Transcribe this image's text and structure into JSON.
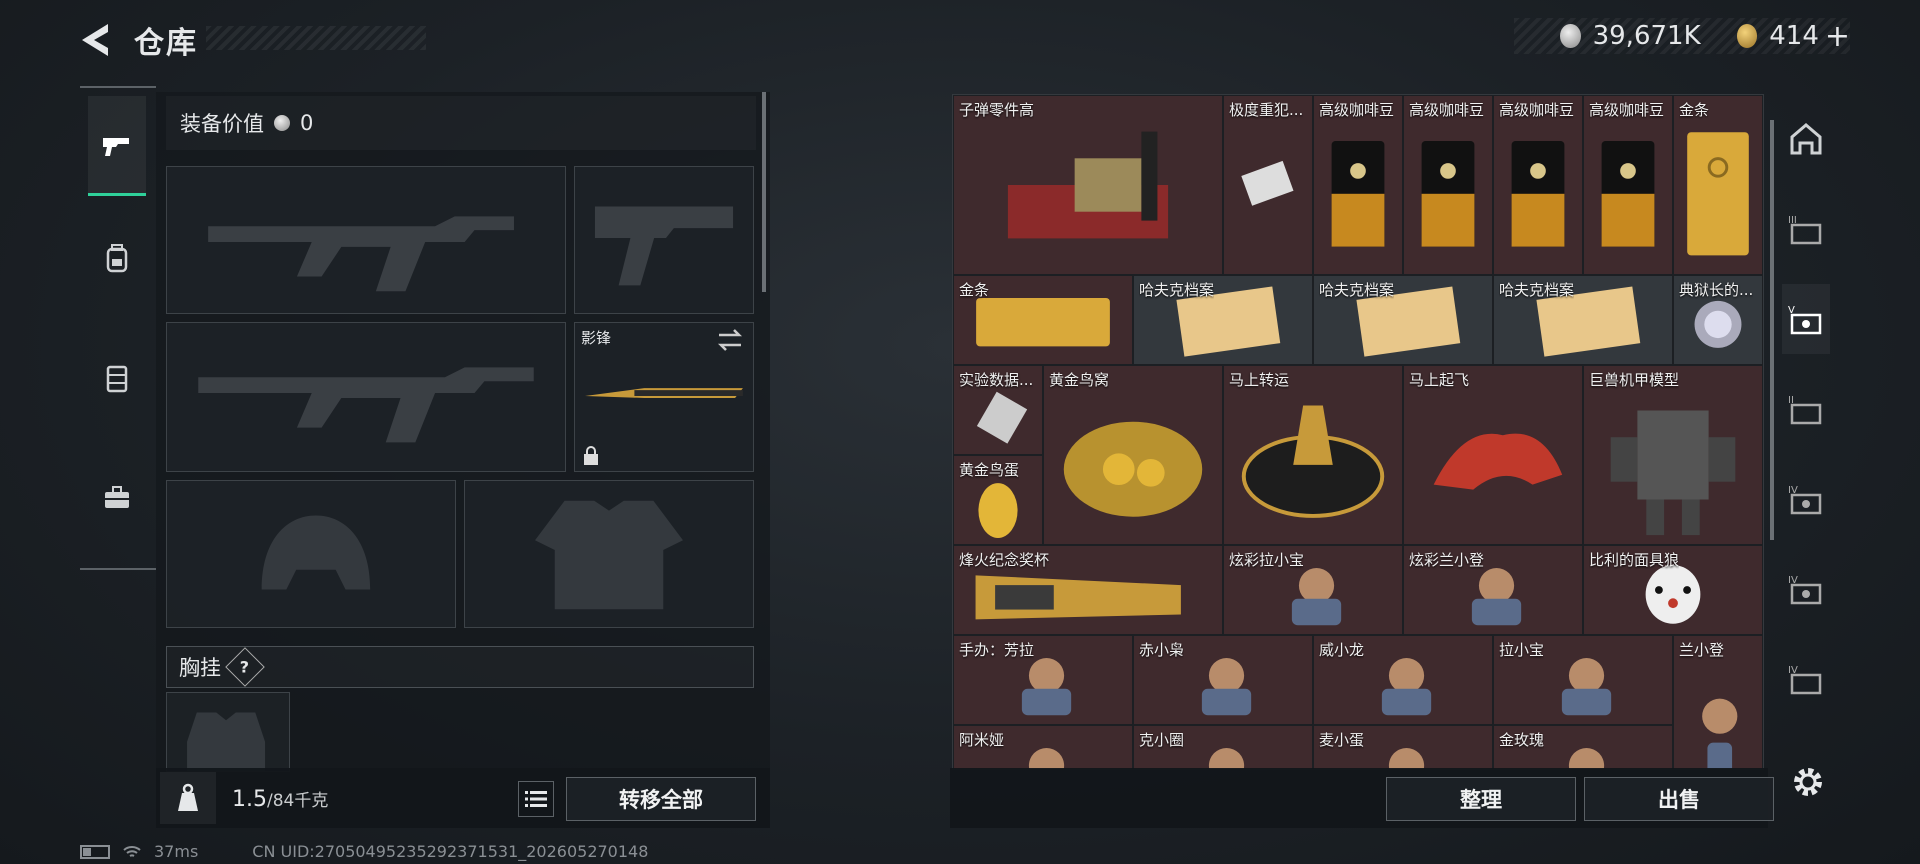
{
  "header": {
    "title": "仓库",
    "back_icon": "back-arrow-icon"
  },
  "currency": {
    "silver": "39,671K",
    "gold": "414",
    "gold_plus": "+"
  },
  "equip": {
    "label": "装备价值",
    "value": "0"
  },
  "slots": {
    "melee_name": "影锋"
  },
  "vest": {
    "label": "胸挂",
    "help": "?"
  },
  "weight": {
    "current": "1.5",
    "max": "/84千克"
  },
  "buttons": {
    "transfer_all": "转移全部",
    "organize": "整理",
    "sell": "出售"
  },
  "status": {
    "ping": "37ms",
    "uid": "CN UID:27050495235292371531_202605270148"
  },
  "left_tabs": [
    "pistol-icon",
    "backpack-icon",
    "vest-icon",
    "briefcase-icon"
  ],
  "right_tabs": [
    "home-icon",
    "tier-iii-case-icon",
    "tier-v-case-icon",
    "tier-ii-case-icon",
    "tier-iv-case-icon",
    "tier-iv-case-alt-icon",
    "tier-iv-folder-icon"
  ],
  "items": [
    {
      "label": "子弹零件高"
    },
    {
      "label": "极度重犯..."
    },
    {
      "label": "高级咖啡豆"
    },
    {
      "label": "高级咖啡豆"
    },
    {
      "label": "高级咖啡豆"
    },
    {
      "label": "高级咖啡豆"
    },
    {
      "label": "金条"
    },
    {
      "label": "金条"
    },
    {
      "label": "哈夫克档案"
    },
    {
      "label": "哈夫克档案"
    },
    {
      "label": "哈夫克档案"
    },
    {
      "label": "典狱长的..."
    },
    {
      "label": "实验数据..."
    },
    {
      "label": "黄金鸟窝"
    },
    {
      "label": "马上转运"
    },
    {
      "label": "马上起飞"
    },
    {
      "label": "巨兽机甲模型"
    },
    {
      "label": "黄金鸟蛋"
    },
    {
      "label": "烽火纪念奖杯"
    },
    {
      "label": "炫彩拉小宝"
    },
    {
      "label": "炫彩兰小登"
    },
    {
      "label": "比利的面具狼"
    },
    {
      "label": "手办：芳拉"
    },
    {
      "label": "赤小枭"
    },
    {
      "label": "威小龙"
    },
    {
      "label": "拉小宝"
    },
    {
      "label": "兰小登"
    },
    {
      "label": "阿米娅"
    },
    {
      "label": "克小圈"
    },
    {
      "label": "麦小蛋"
    },
    {
      "label": "金玫瑰"
    }
  ],
  "colors": {
    "accent": "#2fd19a",
    "item_bg": "#3f2a2d",
    "gold": "#d9a93a"
  }
}
